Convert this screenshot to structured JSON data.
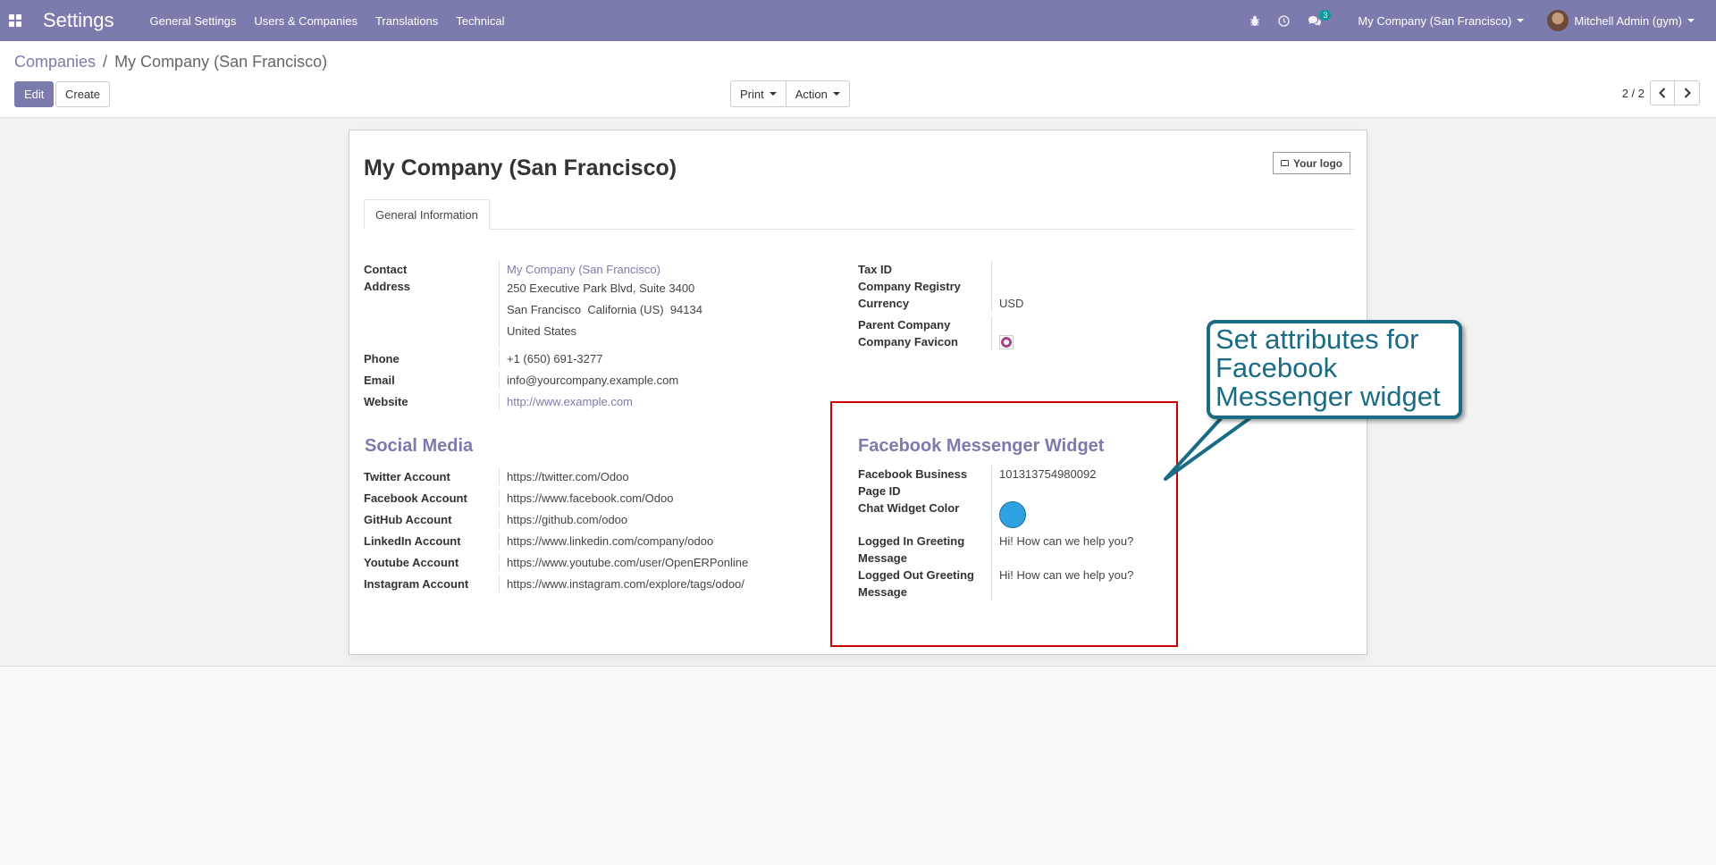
{
  "navbar": {
    "app_title": "Settings",
    "menu": [
      "General Settings",
      "Users & Companies",
      "Translations",
      "Technical"
    ],
    "messages_count": "3",
    "company": "My Company (San Francisco)",
    "user": "Mitchell Admin (gym)",
    "accent_color": "#7c7bad"
  },
  "breadcrumb": {
    "parent": "Companies",
    "separator": "/",
    "current": "My Company (San Francisco)"
  },
  "actions": {
    "edit": "Edit",
    "create": "Create",
    "print": "Print",
    "action": "Action"
  },
  "pager": {
    "value": "2 / 2"
  },
  "form": {
    "company_name": "My Company (San Francisco)",
    "logo_button": "Your logo",
    "tab": "General Information",
    "contact_label": "Contact",
    "contact_value": "My Company (San Francisco)",
    "address_label": "Address",
    "address_line1": "250 Executive Park Blvd, Suite 3400",
    "address_city": "San Francisco",
    "address_state": "California (US)",
    "address_zip": "94134",
    "address_country": "United States",
    "phone_label": "Phone",
    "phone_value": "+1 (650) 691-3277",
    "email_label": "Email",
    "email_value": "info@yourcompany.example.com",
    "website_label": "Website",
    "website_value": "http://www.example.com",
    "tax_id_label": "Tax ID",
    "registry_label": "Company Registry",
    "currency_label": "Currency",
    "currency_value": "USD",
    "parent_label": "Parent Company",
    "favicon_label": "Company Favicon"
  },
  "social": {
    "title": "Social Media",
    "twitter_label": "Twitter Account",
    "twitter_value": "https://twitter.com/Odoo",
    "facebook_label": "Facebook Account",
    "facebook_value": "https://www.facebook.com/Odoo",
    "github_label": "GitHub Account",
    "github_value": "https://github.com/odoo",
    "linkedin_label": "LinkedIn Account",
    "linkedin_value": "https://www.linkedin.com/company/odoo",
    "youtube_label": "Youtube Account",
    "youtube_value": "https://www.youtube.com/user/OpenERPonline",
    "instagram_label": "Instagram Account",
    "instagram_value": "https://www.instagram.com/explore/tags/odoo/"
  },
  "messenger": {
    "title": "Facebook Messenger Widget",
    "page_id_label_1": "Facebook Business",
    "page_id_label_2": "Page ID",
    "page_id_value": "101313754980092",
    "color_label": "Chat Widget Color",
    "widget_color": "#2fa3e1",
    "logged_in_label_1": "Logged In Greeting",
    "logged_in_label_2": "Message",
    "logged_in_value": "Hi! How can we help you?",
    "logged_out_label_1": "Logged Out Greeting",
    "logged_out_label_2": "Message",
    "logged_out_value": "Hi! How can we help you?"
  },
  "callout": {
    "line1": "Set attributes for",
    "line2": "Facebook",
    "line3": "Messenger widget"
  }
}
